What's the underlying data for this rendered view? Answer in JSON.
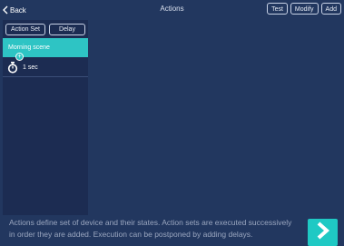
{
  "navbar": {
    "back_label": "Back",
    "title": "Actions",
    "buttons": {
      "test": "Test",
      "modify": "Modify",
      "add": "Add"
    }
  },
  "left_panel": {
    "action_set_label": "Action Set",
    "delay_label": "Delay",
    "items": [
      {
        "type": "action-set",
        "label": "Morning scene",
        "selected": true
      },
      {
        "type": "delay",
        "label": "1 sec"
      }
    ]
  },
  "footer": {
    "description": "Actions define set of device and their states. Action sets are executed successively in order they are added. Execution can be postponed by adding delays."
  },
  "icons": {
    "back": "chevron-left-icon",
    "add": "plus-icon",
    "timer": "stopwatch-icon",
    "next": "chevron-right-icon"
  },
  "colors": {
    "background": "#22375f",
    "panel": "#1c2c52",
    "accent": "#2ec4c4",
    "next_button": "#1fc9c4"
  }
}
